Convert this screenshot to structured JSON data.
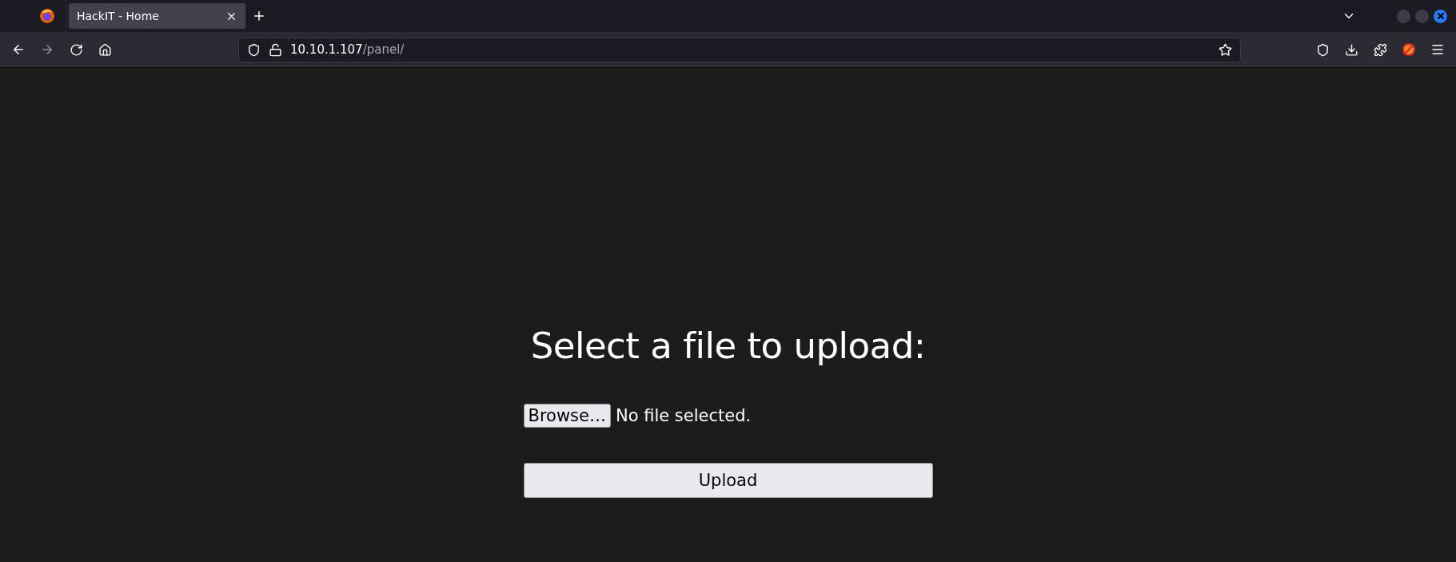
{
  "tabs": [
    {
      "title": "HackIT - Home",
      "selected": true
    }
  ],
  "address_bar": {
    "host": "10.10.1.107",
    "path": "/panel/"
  },
  "page": {
    "heading": "Select a file to upload:",
    "browse_button": "Browse…",
    "file_status": "No file selected.",
    "upload_button": "Upload"
  }
}
